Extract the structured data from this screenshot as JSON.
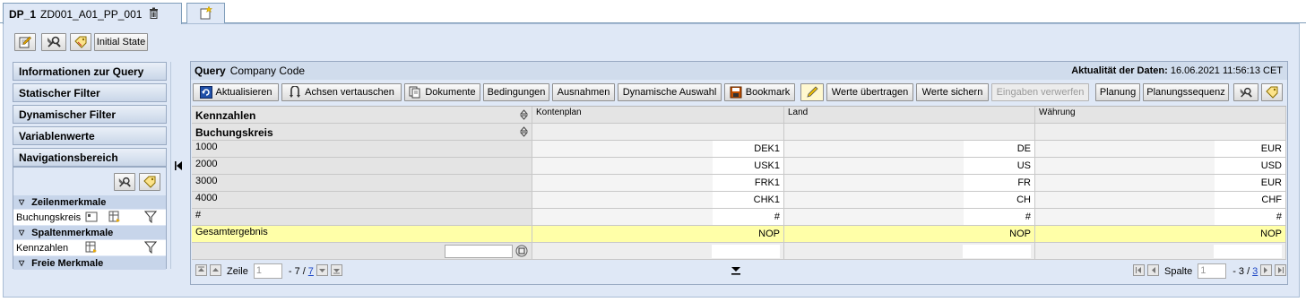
{
  "tabs": {
    "name": "DP_1",
    "sub": "ZD001_A01_PP_001"
  },
  "top_toolbar": {
    "initial_state_label": "Initial State"
  },
  "left_nav": {
    "items": [
      "Informationen zur Query",
      "Statischer Filter",
      "Dynamischer Filter",
      "Variablenwerte",
      "Navigationsbereich"
    ],
    "sections": {
      "rows": "Zeilenmerkmale",
      "cols": "Spaltenmerkmale",
      "free": "Freie Merkmale"
    },
    "row_items": [
      "Buchungskreis"
    ],
    "col_items": [
      "Kennzahlen"
    ]
  },
  "query": {
    "label": "Query",
    "name": "Company Code",
    "freshness_label": "Aktualität der Daten:",
    "freshness_value": "16.06.2021 11:56:13 CET"
  },
  "toolbar": {
    "aktualisieren": "Aktualisieren",
    "achsen": "Achsen vertauschen",
    "dokumente": "Dokumente",
    "bedingungen": "Bedingungen",
    "ausnahmen": "Ausnahmen",
    "dyn_auswahl": "Dynamische Auswahl",
    "bookmark": "Bookmark",
    "werte_uebertragen": "Werte übertragen",
    "werte_sichern": "Werte sichern",
    "eingaben_verwerfen": "Eingaben verwerfen",
    "planung": "Planung",
    "planungssequenz": "Planungssequenz"
  },
  "table": {
    "col_headers": [
      "Kontenplan",
      "Land",
      "Währung"
    ],
    "dim_headers": [
      "Kennzahlen",
      "Buchungskreis"
    ],
    "rows": [
      {
        "key": "1000",
        "v": [
          "DEK1",
          "DE",
          "EUR"
        ]
      },
      {
        "key": "2000",
        "v": [
          "USK1",
          "US",
          "USD"
        ]
      },
      {
        "key": "3000",
        "v": [
          "FRK1",
          "FR",
          "EUR"
        ]
      },
      {
        "key": "4000",
        "v": [
          "CHK1",
          "CH",
          "CHF"
        ]
      },
      {
        "key": "#",
        "v": [
          "#",
          "#",
          "#"
        ]
      }
    ],
    "total": {
      "key": "Gesamtergebnis",
      "v": [
        "NOP",
        "NOP",
        "NOP"
      ]
    }
  },
  "footer": {
    "zeile_label": "Zeile",
    "zeile_value": "1",
    "zeile_sep": "- 7 /",
    "zeile_total": "7",
    "spalte_label": "Spalte",
    "spalte_value": "1",
    "spalte_sep": "- 3 /",
    "spalte_total": "3"
  }
}
